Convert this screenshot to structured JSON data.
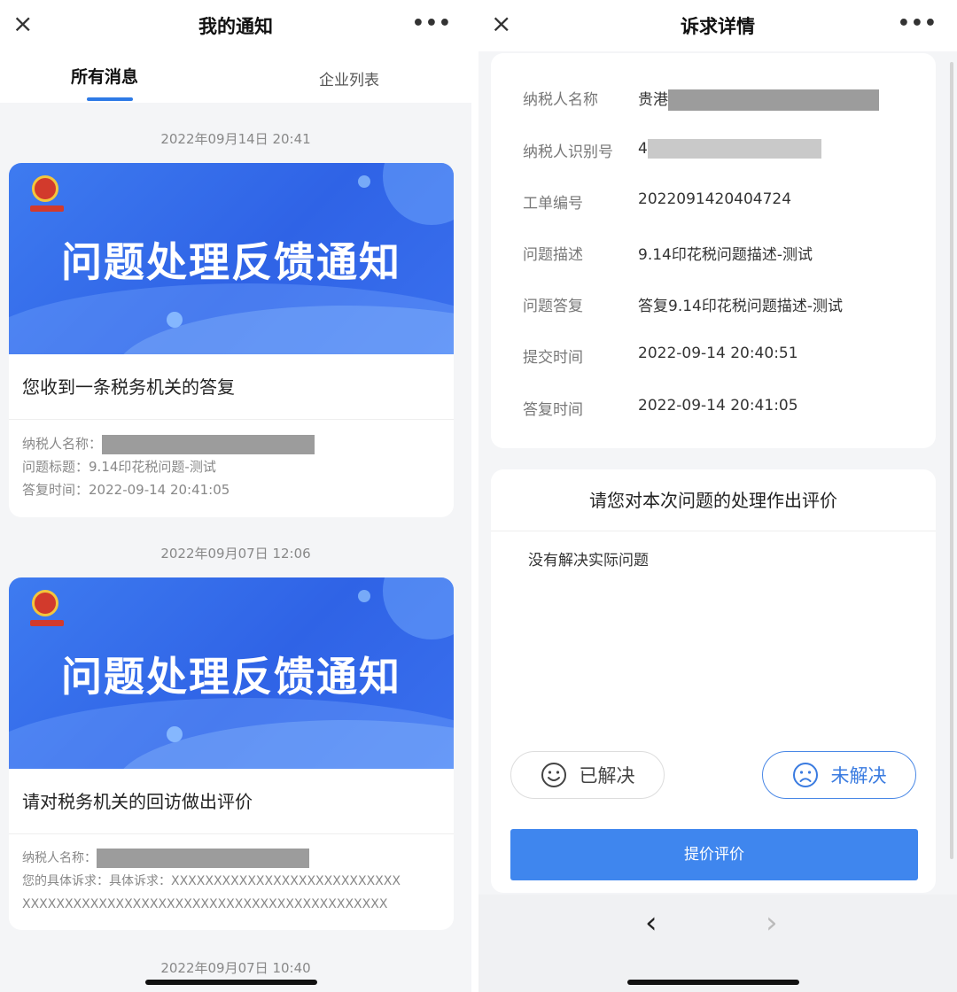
{
  "left": {
    "nav_title": "我的通知",
    "close_icon": "×",
    "more_icon": "•••",
    "tabs": [
      "所有消息",
      "企业列表"
    ],
    "items": [
      {
        "timestamp": "2022年09月14日 20:41",
        "banner_title": "问题处理反馈通知",
        "message": "您收到一条税务机关的答复",
        "meta": [
          {
            "label": "纳税人名称：",
            "value": ""
          },
          {
            "label": "问题标题：",
            "value": "9.14印花税问题-测试"
          },
          {
            "label": "答复时间：",
            "value": "2022-09-14 20:41:05"
          }
        ]
      },
      {
        "timestamp": "2022年09月07日 12:06",
        "banner_title": "问题处理反馈通知",
        "message": "请对税务机关的回访做出评价",
        "meta": [
          {
            "label": "纳税人名称：",
            "value": ""
          },
          {
            "label": "您的具体诉求：",
            "value": "具体诉求：XXXXXXXXXXXXXXXXXXXXXXXXXXX"
          },
          {
            "label": "",
            "value": "XXXXXXXXXXXXXXXXXXXXXXXXXXXXXXXXXXXXXXXXXXX"
          }
        ]
      },
      {
        "timestamp": "2022年09月07日 10:40"
      }
    ]
  },
  "right": {
    "nav_title": "诉求详情",
    "close_icon": "×",
    "more_icon": "•••",
    "details": [
      {
        "label": "纳税人名称",
        "value": "贵港"
      },
      {
        "label": "纳税人识别号",
        "value": "4"
      },
      {
        "label": "工单编号",
        "value": "2022091420404724"
      },
      {
        "label": "问题描述",
        "value": "9.14印花税问题描述-测试"
      },
      {
        "label": "问题答复",
        "value": "答复9.14印花税问题描述-测试"
      },
      {
        "label": "提交时间",
        "value": "2022-09-14 20:40:51"
      },
      {
        "label": "答复时间",
        "value": "2022-09-14 20:41:05"
      }
    ],
    "eval_title": "请您对本次问题的处理作出评价",
    "eval_comment": "没有解决实际问题",
    "btn_solved": "已解决",
    "btn_unsolved": "未解决",
    "submit": "提价评价",
    "nav_back": "‹",
    "nav_forward": "›"
  },
  "colors": {
    "accent": "#2d7ae6",
    "banner": "#3e7bf0",
    "submit": "#3f86ee",
    "redaction": "#9c9c9c"
  }
}
